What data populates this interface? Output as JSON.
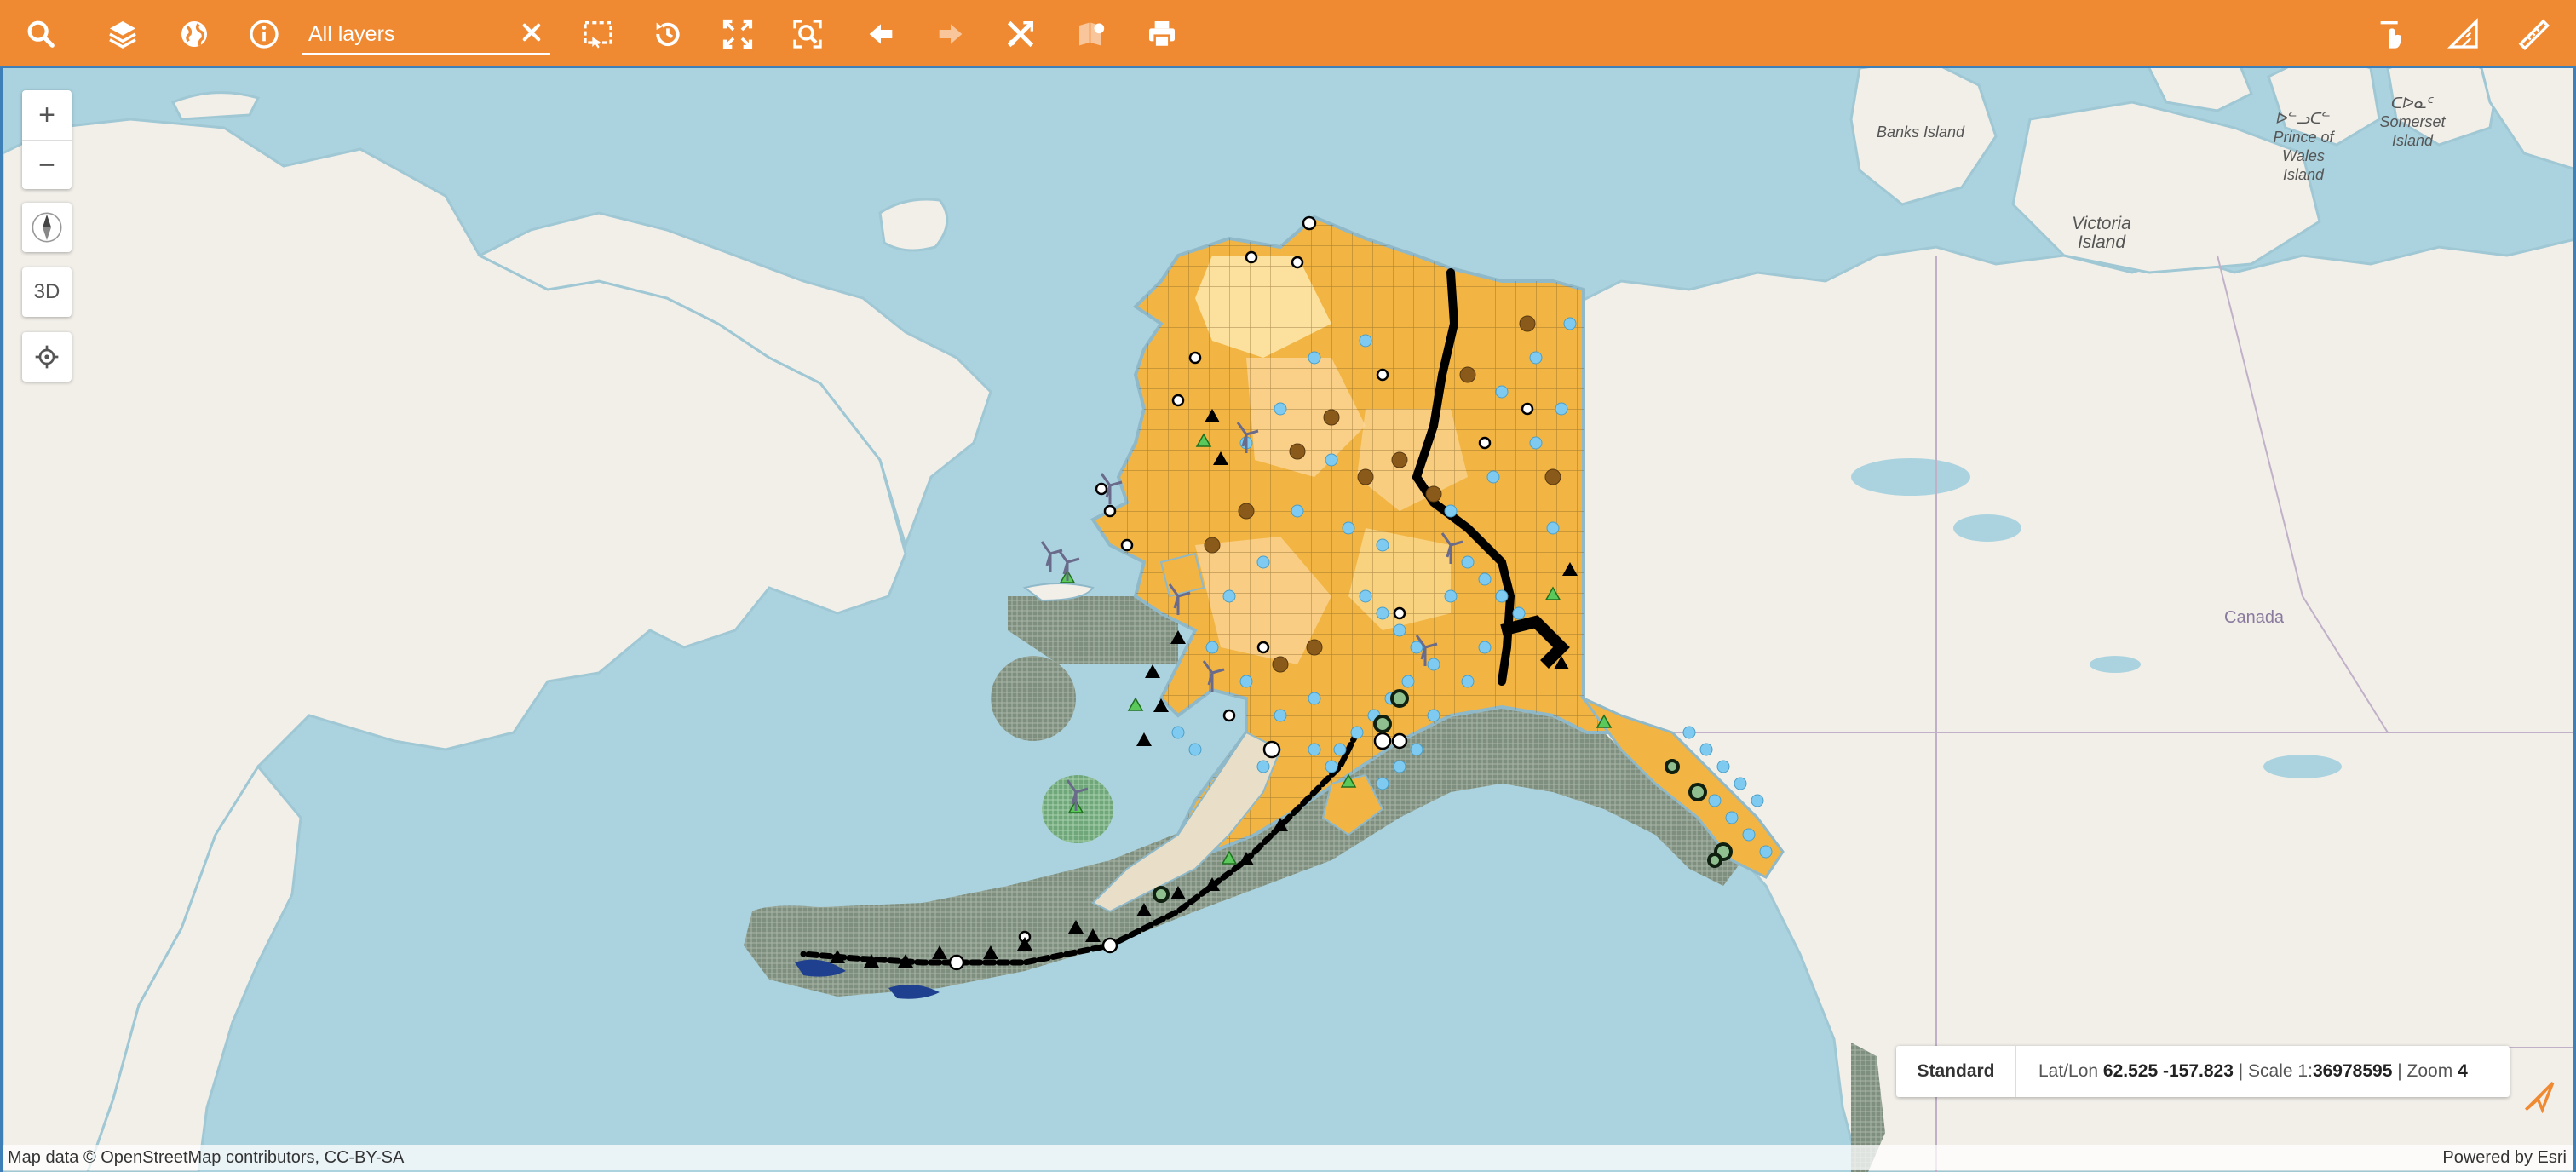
{
  "toolbar": {
    "accent_color": "#f08a32",
    "left_tools": [
      {
        "icon": "search-icon"
      },
      {
        "icon": "layers-icon"
      },
      {
        "icon": "globe-icon"
      },
      {
        "icon": "info-icon"
      }
    ],
    "search": {
      "value": "",
      "placeholder": "All layers"
    },
    "right_tools": [
      {
        "icon": "select-area-icon"
      },
      {
        "icon": "history-icon"
      },
      {
        "icon": "full-extent-icon"
      },
      {
        "icon": "zoom-to-selection-icon"
      },
      {
        "icon": "arrow-back-icon"
      },
      {
        "icon": "arrow-forward-icon"
      },
      {
        "icon": "draw-tools-icon"
      },
      {
        "icon": "shapes-icon"
      },
      {
        "icon": "print-icon"
      }
    ],
    "far_right_tools": [
      {
        "icon": "pan-hand-icon"
      },
      {
        "icon": "measure-area-icon"
      },
      {
        "icon": "measure-distance-icon"
      }
    ]
  },
  "map_controls": {
    "zoom_in": "+",
    "zoom_out": "−",
    "btn_3d": "3D"
  },
  "place_labels": {
    "banks_island": "Banks Island",
    "prince_wales_native": "ᐅᓪᓗᑕᓪ",
    "prince_wales": "Prince of Wales Island",
    "somerset_native": "ᑕᐅᓇᑦ",
    "somerset": "Somerset Island",
    "victoria": "Victoria Island",
    "canada": "Canada"
  },
  "status": {
    "basemap": "Standard",
    "latlon_label": "Lat/Lon",
    "latlon_value": "62.525 -157.823",
    "scale_label": "Scale 1:",
    "scale_value": "36978595",
    "zoom_label": "Zoom",
    "zoom_value": "4"
  },
  "attribution": {
    "left": "Map data © OpenStreetMap contributors, CC-BY-SA",
    "right": "Powered by Esri"
  },
  "colors": {
    "water": "#abd3df",
    "land": "#f2efe9",
    "alaska_fill": "#f2b544",
    "boundary": "#c0b0c8"
  }
}
